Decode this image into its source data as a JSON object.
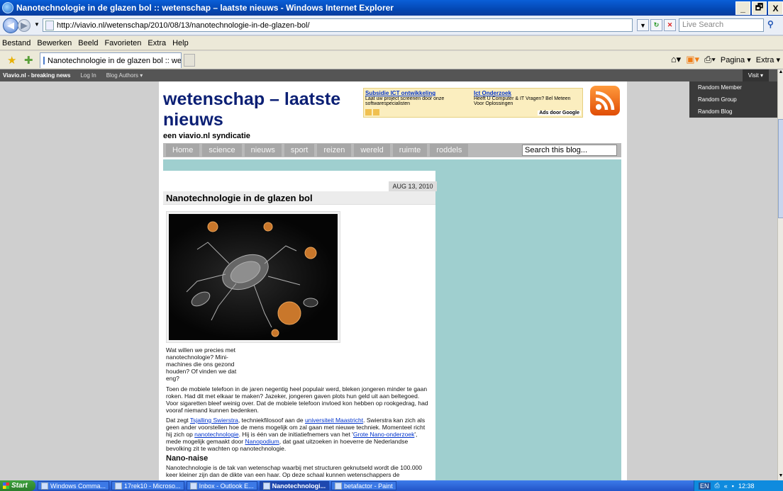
{
  "window": {
    "title": "Nanotechnologie in de glazen bol :: wetenschap – laatste nieuws - Windows Internet Explorer",
    "controls": [
      "_",
      "🗗",
      "X"
    ]
  },
  "address": {
    "url": "http://viavio.nl/wetenschap/2010/08/13/nanotechnologie-in-de-glazen-bol/",
    "search_placeholder": "Live Search"
  },
  "menubar": [
    "Bestand",
    "Bewerken",
    "Beeld",
    "Favorieten",
    "Extra",
    "Help"
  ],
  "tab": {
    "label": "Nanotechnologie in de glazen bol :: weten..."
  },
  "command_bar": {
    "page_label": "Pagina",
    "extra_label": "Extra"
  },
  "wp_adminbar": {
    "brand": "Viavio.nl - breaking news",
    "login": "Log In",
    "blog_authors": "Blog Authors ▾",
    "visit": "Visit ▾",
    "visit_menu": [
      "Random Member",
      "Random Group",
      "Random Blog"
    ]
  },
  "blog": {
    "title": "wetenschap – laatste nieuws",
    "tagline": "een viavio.nl syndicatie",
    "nav": [
      "Home",
      "science",
      "nieuws",
      "sport",
      "reizen",
      "wereld",
      "ruimte",
      "roddels"
    ],
    "search_placeholder": "Search this blog...",
    "ads": {
      "ad1_title": "Subsidie ICT ontwikkeling",
      "ad1_text": "Laat uw project screenen door onze softwarespecialisten",
      "ad2_title": "Ict Onderzoek",
      "ad2_text": "Heeft U Computer & IT Vragen? Bel Meteen Voor Oplossingen",
      "ads_by": "Ads door Google"
    }
  },
  "post": {
    "date": "AUG 13, 2010",
    "title": "Nanotechnologie in de glazen bol",
    "intro": "Wat willen we precies met nanotechnologie? Mini-machines die ons gezond houden? Of vinden we dat eng?",
    "p1": "Toen de mobiele telefoon in de jaren negentig heel populair werd, bleken jongeren minder te gaan roken. Had dit met elkaar te maken? Jazeker, jongeren gaven plots hun geld uit aan beltegoed. Voor sigaretten bleef weinig over. Dat de mobiele telefoon invloed kon hebben op rookgedrag, had vooraf niemand kunnen bedenken.",
    "p2_a": "Dat zegt ",
    "p2_link1": "Tsjalling Swierstra",
    "p2_b": ", techniekfilosoof aan de ",
    "p2_link2": "universiteit Maastricht",
    "p2_c": ". Swierstra kan zich als geen ander voorstellen hoe de mens mogelijk om zal gaan met nieuwe techniek. Momenteel richt hij zich op ",
    "p2_link3": "nanotechnologie",
    "p2_d": ". Hij is één van de initiatiefnemers van het '",
    "p2_link4": "Grote Nano-onderzoek",
    "p2_e": "', mede mogelijk gemaakt door ",
    "p2_link5": "Nanopodium",
    "p2_f": ", dat gaat uitzoeken in hoeverre de Nederlandse bevolking zit te wachten op nanotechnologie.",
    "subheading": "Nano-naise",
    "p3": "Nanotechnologie is de tak van wetenschap waarbij met structuren geknutseld wordt die 100.000 keer kleiner zijn dan de dikte van een haar. Op deze schaal kunnen wetenschappers de"
  },
  "taskbar": {
    "start": "Start",
    "tasks": [
      "Windows Comma...",
      "17rek10 - Microso...",
      "Inbox - Outlook E...",
      "Nanotechnologi...",
      "betafactor - Paint"
    ],
    "active_index": 3,
    "lang": "EN",
    "clock": "12:38"
  }
}
